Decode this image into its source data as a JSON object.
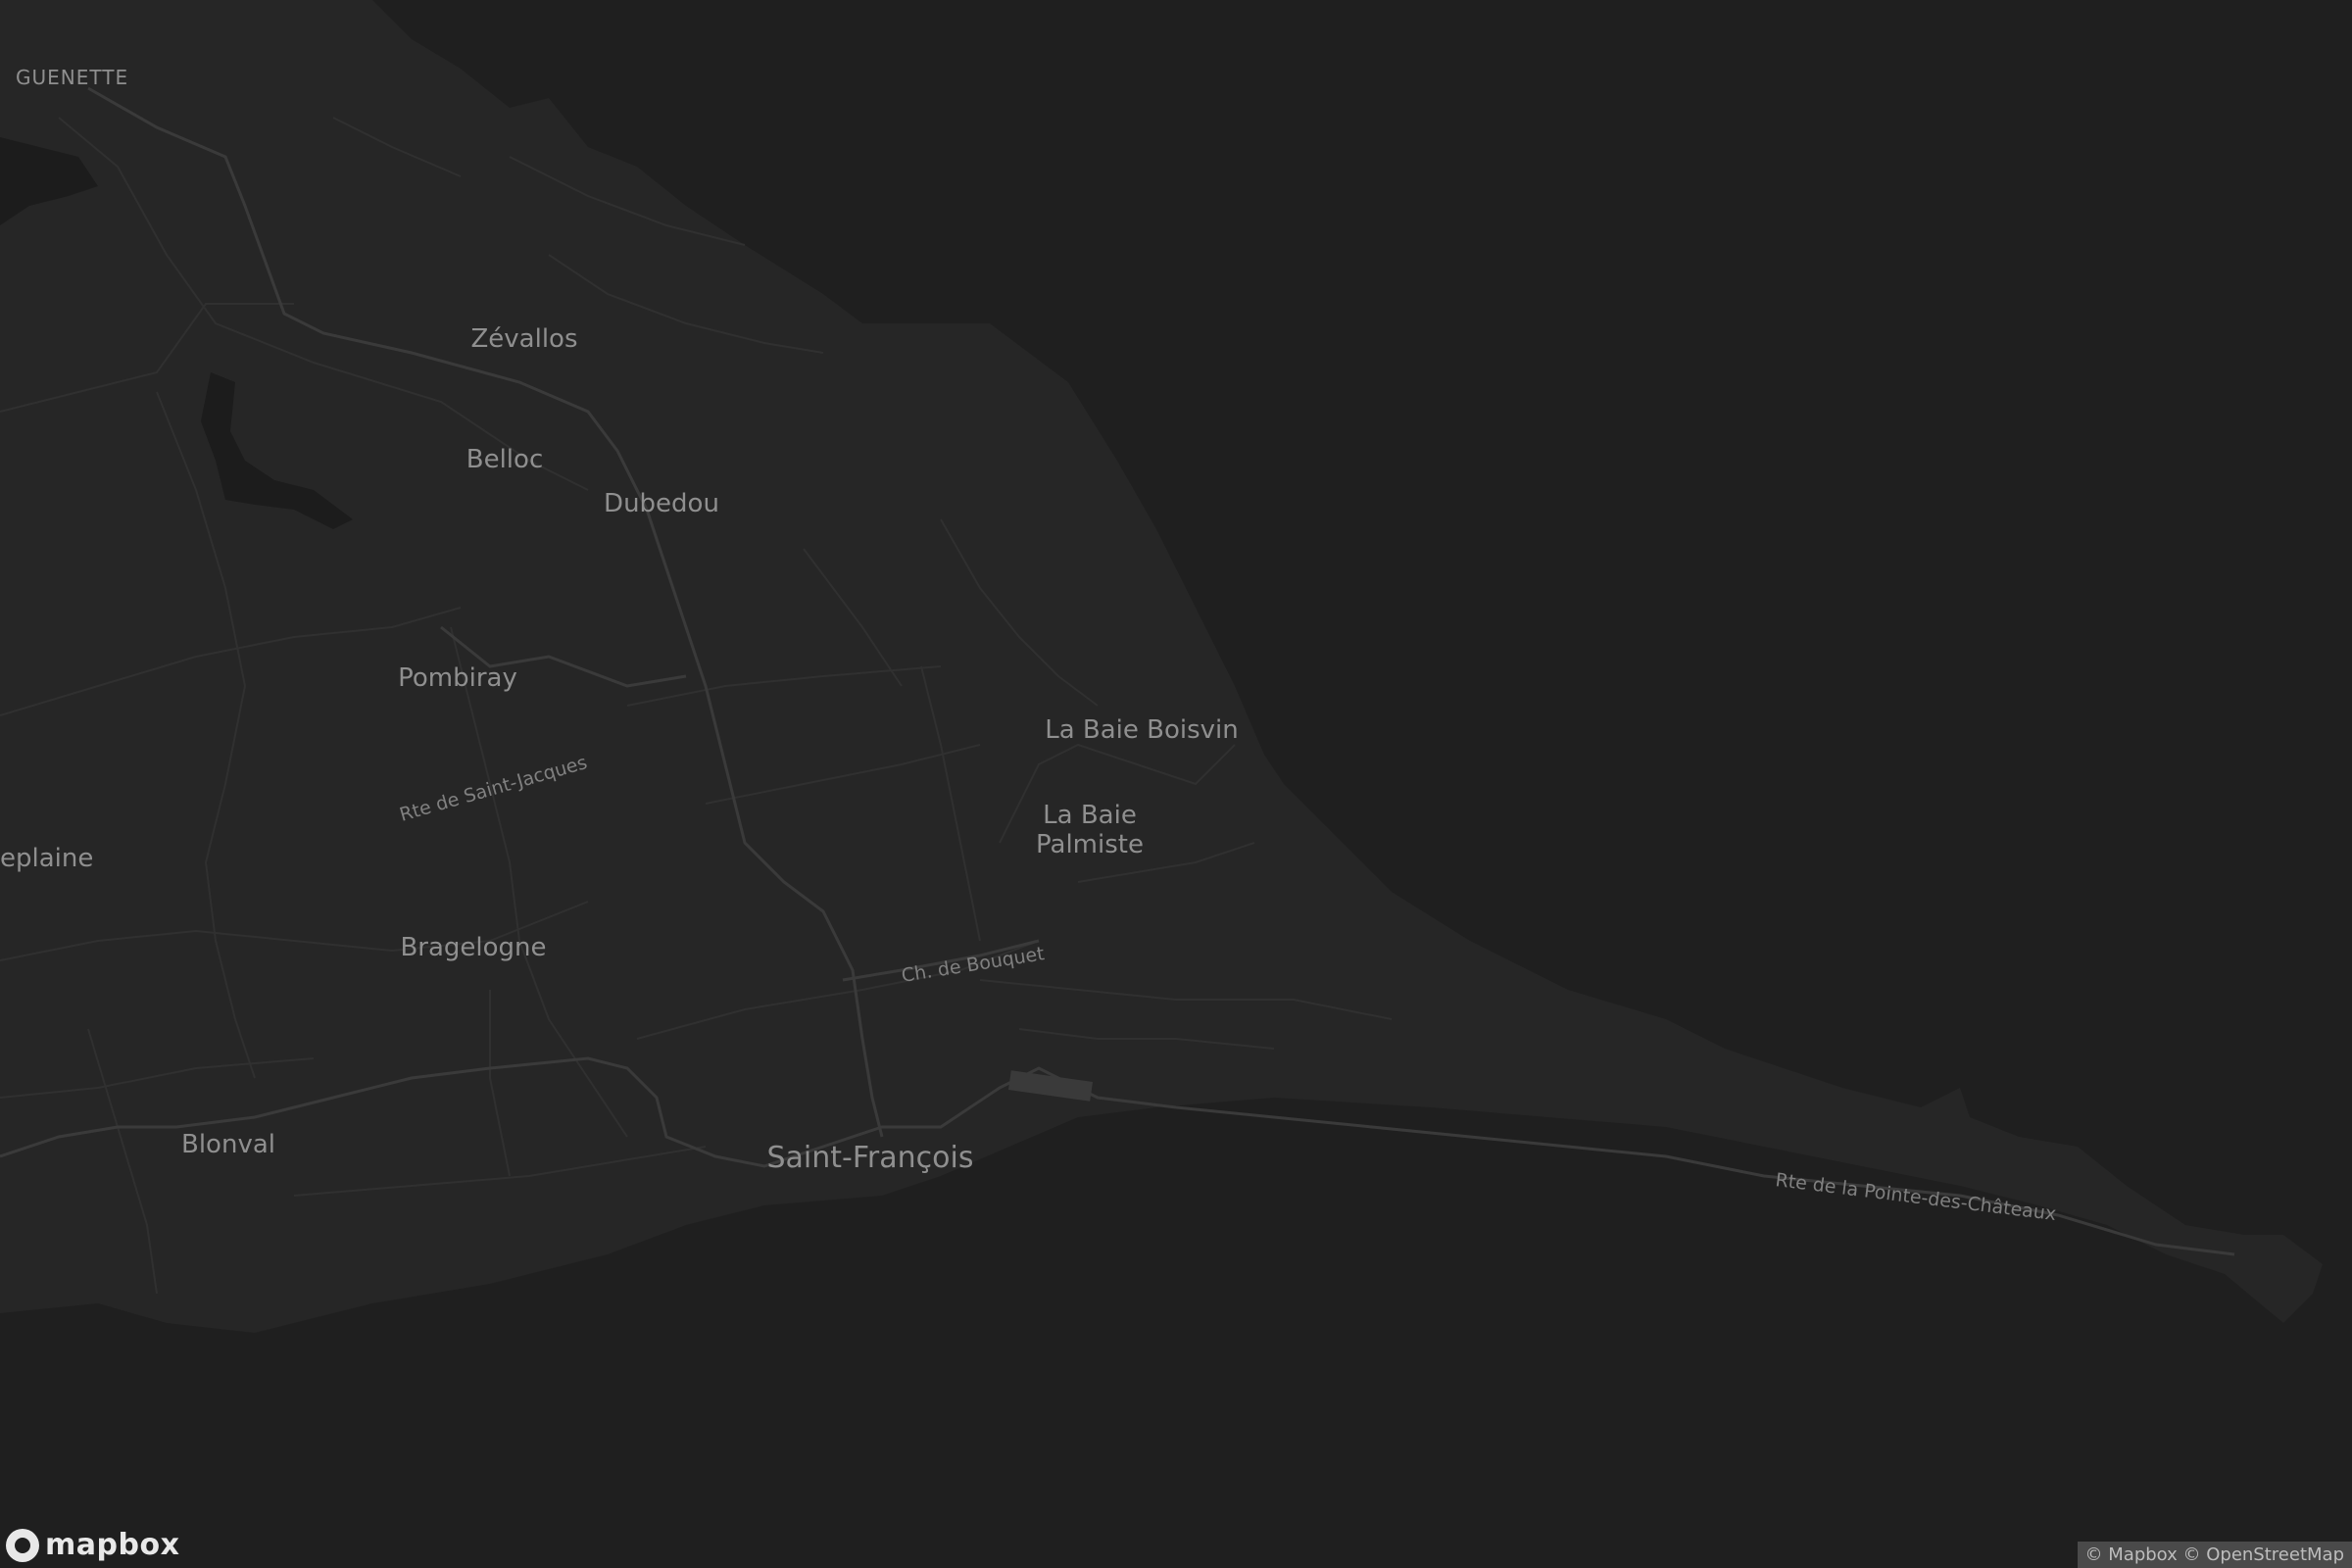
{
  "map": {
    "places": [
      {
        "id": "guenette",
        "label": "GUENETTE"
      },
      {
        "id": "zevallos",
        "label": "Zévallos"
      },
      {
        "id": "belloc",
        "label": "Belloc"
      },
      {
        "id": "dubedou",
        "label": "Dubedou"
      },
      {
        "id": "pombiray",
        "label": "Pombiray"
      },
      {
        "id": "eplaine",
        "label": "eplaine"
      },
      {
        "id": "bragelogne",
        "label": "Bragelogne"
      },
      {
        "id": "blonval",
        "label": "Blonval"
      },
      {
        "id": "saint-francois",
        "label": "Saint-François"
      },
      {
        "id": "la-baie-boisvin",
        "label": "La Baie Boisvin"
      },
      {
        "id": "la-baie-palmiste-1",
        "label": "La Baie"
      },
      {
        "id": "la-baie-palmiste-2",
        "label": "Palmiste"
      }
    ],
    "roads": [
      {
        "id": "rte-saint-jacques",
        "label": "Rte de Saint-Jacques"
      },
      {
        "id": "ch-bouquet",
        "label": "Ch. de Bouquet"
      },
      {
        "id": "rte-pointe-chateaux",
        "label": "Rte de la Pointe-des-Châteaux"
      }
    ],
    "colors": {
      "water": "#1f1f1f",
      "land": "#262626",
      "road": "#3a3a3a",
      "label": "#8f8f8f"
    }
  },
  "logo": {
    "text": "mapbox",
    "icon": "mapbox-logo-icon"
  },
  "attribution": {
    "text": "© Mapbox © OpenStreetMap"
  }
}
